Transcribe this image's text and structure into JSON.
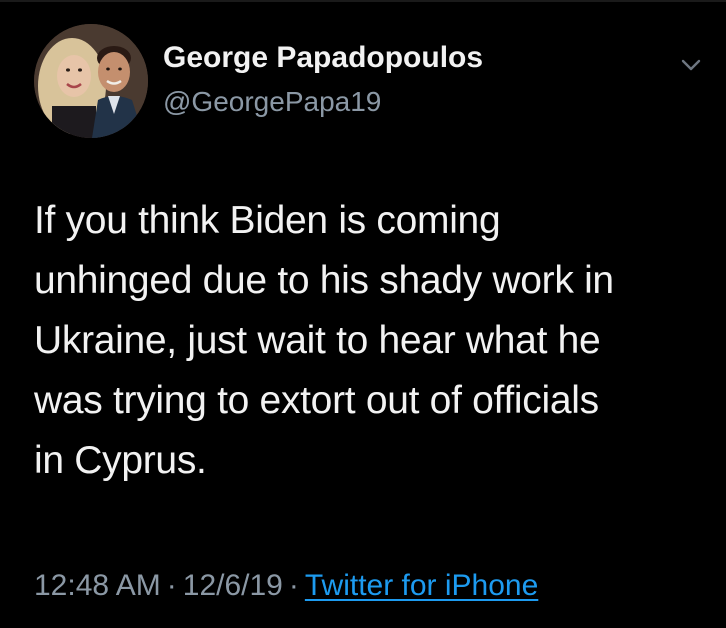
{
  "tweet": {
    "author": {
      "display_name": "George Papadopoulos",
      "handle": "@GeorgePapa19",
      "avatar_icon": "profile-photo"
    },
    "text_lines": [
      "If you think Biden is coming",
      "unhinged due to his shady work in",
      "Ukraine, just wait to hear what he",
      "was trying to extort out of officials",
      "in Cyprus."
    ],
    "time": "12:48 AM",
    "date": "12/6/19",
    "separator": "·",
    "source": "Twitter for iPhone"
  },
  "icons": {
    "more": "chevron-down-icon"
  },
  "colors": {
    "background": "#000000",
    "text": "#f2f2f2",
    "secondary": "#8b98a5",
    "link": "#1d9bf0"
  }
}
